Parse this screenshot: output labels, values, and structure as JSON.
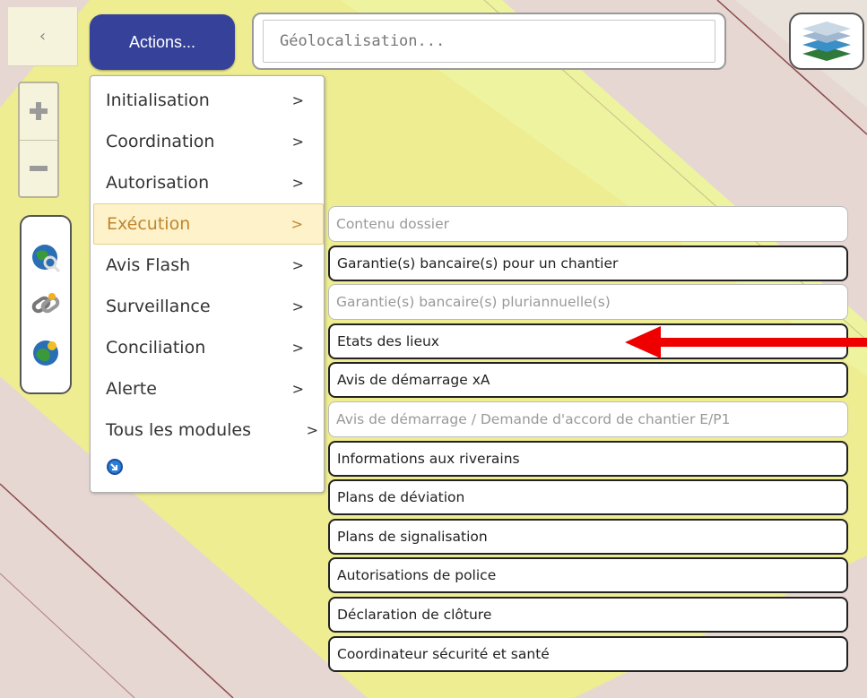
{
  "toolbar": {
    "collapse_glyph": "‹",
    "actions_label": "Actions...",
    "geo_placeholder": "Géolocalisation..."
  },
  "zoom": {
    "in_icon": "plus-icon",
    "out_icon": "minus-icon"
  },
  "tools": [
    "globe-magnifier-icon",
    "chain-link-icon",
    "globe-sun-icon"
  ],
  "main_menu": {
    "items": [
      {
        "label": "Initialisation",
        "arrow": ">"
      },
      {
        "label": "Coordination",
        "arrow": ">"
      },
      {
        "label": "Autorisation",
        "arrow": ">"
      },
      {
        "label": "Exécution",
        "arrow": ">",
        "active": true
      },
      {
        "label": "Avis Flash",
        "arrow": ">"
      },
      {
        "label": "Surveillance",
        "arrow": ">"
      },
      {
        "label": "Conciliation",
        "arrow": ">"
      },
      {
        "label": "Alerte",
        "arrow": ">"
      },
      {
        "label": "Tous les modules",
        "arrow": ">"
      }
    ],
    "footer_icon": "blue-circle-arrow-icon"
  },
  "sub_menu": {
    "items": [
      {
        "label": "Contenu dossier",
        "disabled": true
      },
      {
        "label": "Garantie(s) bancaire(s) pour un chantier",
        "disabled": false
      },
      {
        "label": "Garantie(s) bancaire(s) pluriannuelle(s)",
        "disabled": true
      },
      {
        "label": "Etats des lieux",
        "disabled": false,
        "highlighted": true
      },
      {
        "label": "Avis de démarrage xA",
        "disabled": false
      },
      {
        "label": "Avis de démarrage / Demande d'accord de chantier E/P1",
        "disabled": true
      },
      {
        "label": "Informations aux riverains",
        "disabled": false
      },
      {
        "label": "Plans de déviation",
        "disabled": false
      },
      {
        "label": "Plans de signalisation",
        "disabled": false
      },
      {
        "label": "Autorisations de police",
        "disabled": false
      },
      {
        "label": "Déclaration de clôture",
        "disabled": false
      },
      {
        "label": "Coordinateur sécurité et santé",
        "disabled": false
      }
    ]
  },
  "colors": {
    "actions_bg": "#36419a",
    "active_text": "#c0862e",
    "active_bg": "#fdf2c9",
    "road_yellow": "#eef08a",
    "parcel_pink": "#e2c5c5",
    "annotation_arrow": "#ee0000"
  }
}
